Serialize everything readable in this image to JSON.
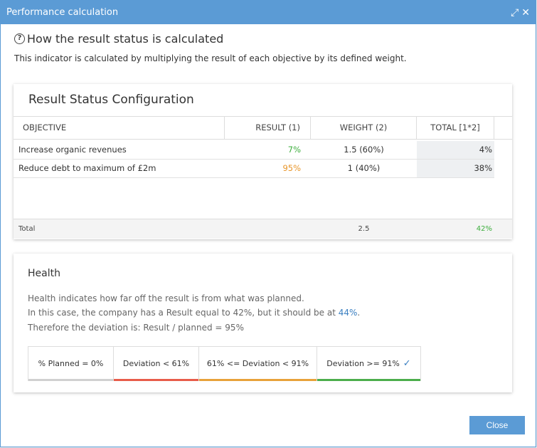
{
  "dialog": {
    "title": "Performance calculation",
    "expand_glyph": "⤢",
    "close_glyph": "✕",
    "heading": "How the result status is calculated",
    "help_glyph": "?",
    "subtitle": "This indicator is calculated by multiplying the result of each objective by its defined weight.",
    "close_button": "Close"
  },
  "config": {
    "title": "Result Status Configuration",
    "columns": [
      "OBJECTIVE",
      "RESULT (1)",
      "WEIGHT (2)",
      "TOTAL [1*2]"
    ],
    "rows": [
      {
        "objective": "Increase organic revenues",
        "result": "7%",
        "weight": "1.5 (60%)",
        "total": "4%"
      },
      {
        "objective": "Reduce debt to maximum of £2m",
        "result": "95%",
        "weight": "1 (40%)",
        "total": "38%"
      }
    ],
    "total": {
      "label": "Total",
      "weight": "2.5",
      "total": "42%"
    }
  },
  "health": {
    "title": "Health",
    "line1": "Health indicates how far off the result is from what was planned.",
    "line2_prefix": "In this case, the company has a Result equal to 42%, but it should be at ",
    "line2_link": "44%",
    "line2_suffix": ".",
    "line3": "Therefore the deviation is: Result / planned = 95%",
    "legend": [
      {
        "label": "% Planned = 0%",
        "color": "#d0d0d0"
      },
      {
        "label": "Deviation < 61%",
        "color": "#e85c4a"
      },
      {
        "label": "61% <= Deviation < 91%",
        "color": "#e8a23a"
      },
      {
        "label": "Deviation >= 91%",
        "color": "#4cae4c",
        "checked": true
      }
    ],
    "check_glyph": "✓"
  },
  "colors": {
    "accent": "#5b9bd5",
    "good": "#3dae3d",
    "warn": "#e8962a"
  }
}
